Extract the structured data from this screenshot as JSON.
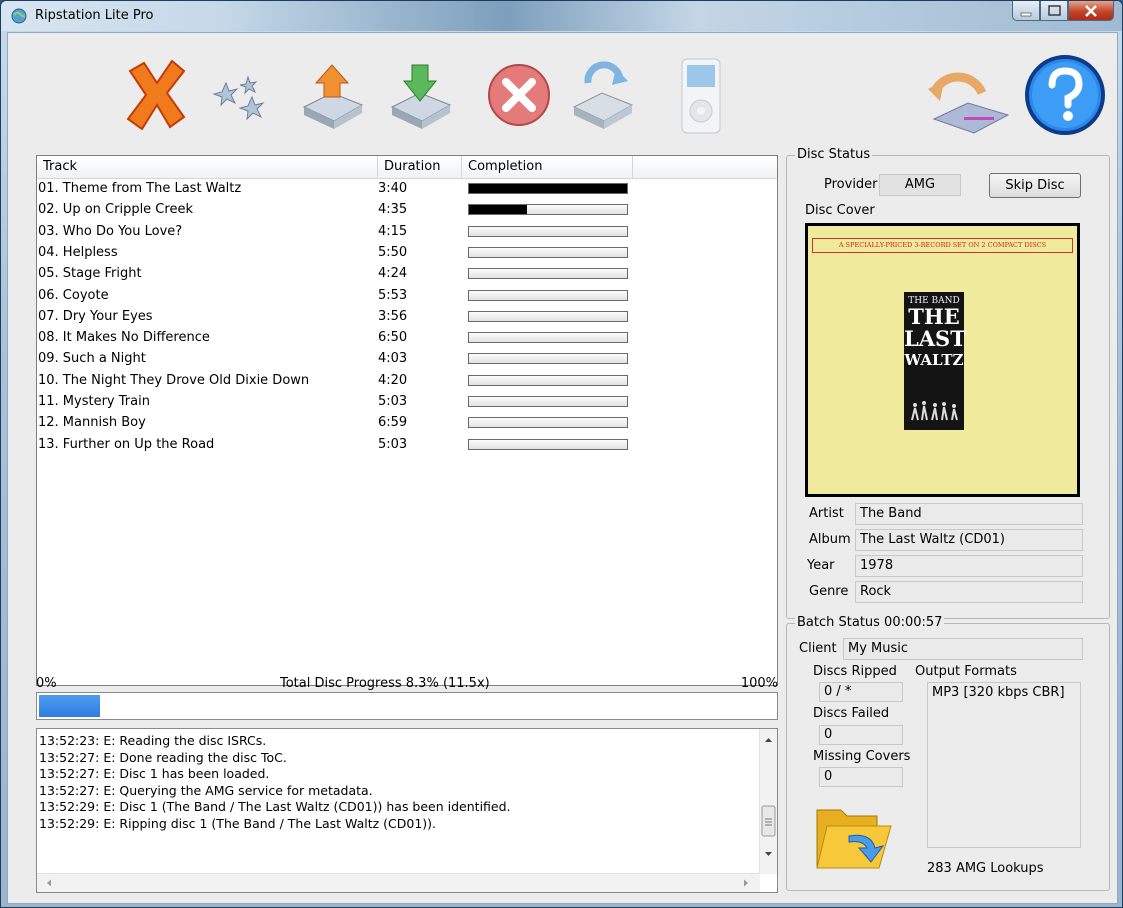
{
  "window": {
    "title": "Ripstation Lite Pro"
  },
  "toolbar": {
    "buttons": [
      {
        "name": "delete-icon"
      },
      {
        "name": "stars-icon"
      },
      {
        "name": "eject-icon"
      },
      {
        "name": "load-icon"
      },
      {
        "name": "cancel-icon"
      },
      {
        "name": "drive-refresh-icon"
      },
      {
        "name": "ipod-icon"
      },
      {
        "name": "network-drive-icon"
      },
      {
        "name": "help-icon"
      }
    ]
  },
  "tracks": {
    "headers": {
      "track": "Track",
      "duration": "Duration",
      "completion": "Completion"
    },
    "rows": [
      {
        "name": "01. Theme from The Last Waltz",
        "duration": "3:40",
        "completion": 1.0
      },
      {
        "name": "02. Up on Cripple Creek",
        "duration": "4:35",
        "completion": 0.37
      },
      {
        "name": "03. Who Do You Love?",
        "duration": "4:15",
        "completion": 0
      },
      {
        "name": "04. Helpless",
        "duration": "5:50",
        "completion": 0
      },
      {
        "name": "05. Stage Fright",
        "duration": "4:24",
        "completion": 0
      },
      {
        "name": "06. Coyote",
        "duration": "5:53",
        "completion": 0
      },
      {
        "name": "07. Dry Your Eyes",
        "duration": "3:56",
        "completion": 0
      },
      {
        "name": "08. It Makes No Difference",
        "duration": "6:50",
        "completion": 0
      },
      {
        "name": "09. Such a Night",
        "duration": "4:03",
        "completion": 0
      },
      {
        "name": "10. The Night They Drove Old Dixie Down",
        "duration": "4:20",
        "completion": 0
      },
      {
        "name": "11. Mystery Train",
        "duration": "5:03",
        "completion": 0
      },
      {
        "name": "12. Mannish Boy",
        "duration": "6:59",
        "completion": 0
      },
      {
        "name": "13. Further on Up the Road",
        "duration": "5:03",
        "completion": 0
      }
    ]
  },
  "progress": {
    "min_label": "0%",
    "max_label": "100%",
    "label": "Total Disc Progress 8.3% (11.5x)",
    "fraction": 0.083
  },
  "log": {
    "lines": [
      "13:52:23: E: Reading the disc ISRCs.",
      "13:52:27: E: Done reading the disc ToC.",
      "13:52:27: E: Disc 1 has been loaded.",
      "13:52:27: E: Querying the AMG service for metadata.",
      "13:52:29: E: Disc 1 (The Band / The Last Waltz (CD01)) has been identified.",
      "13:52:29: E: Ripping disc 1 (The Band / The Last Waltz (CD01))."
    ]
  },
  "disc_status": {
    "title": "Disc Status",
    "provider_label": "Provider",
    "provider_value": "AMG",
    "skip_label": "Skip Disc",
    "cover_label": "Disc Cover",
    "cover_banner": "A SPECIALLY-PRICED 3-RECORD SET ON 2 COMPACT DISCS",
    "cover_line1": "THE BAND",
    "cover_line2": "THE",
    "cover_line3": "LAST",
    "cover_line4": "WALTZ",
    "artist_label": "Artist",
    "artist": "The Band",
    "album_label": "Album",
    "album": "The Last Waltz (CD01)",
    "year_label": "Year",
    "year": "1978",
    "genre_label": "Genre",
    "genre": "Rock"
  },
  "batch_status": {
    "title": "Batch Status 00:00:57",
    "client_label": "Client",
    "client": "My Music",
    "ripped_label": "Discs Ripped",
    "ripped": "0 / *",
    "failed_label": "Discs Failed",
    "failed": "0",
    "missing_label": "Missing Covers",
    "missing": "0",
    "formats_label": "Output Formats",
    "formats": [
      "MP3 [320 kbps CBR]"
    ],
    "lookups": "283 AMG Lookups"
  }
}
